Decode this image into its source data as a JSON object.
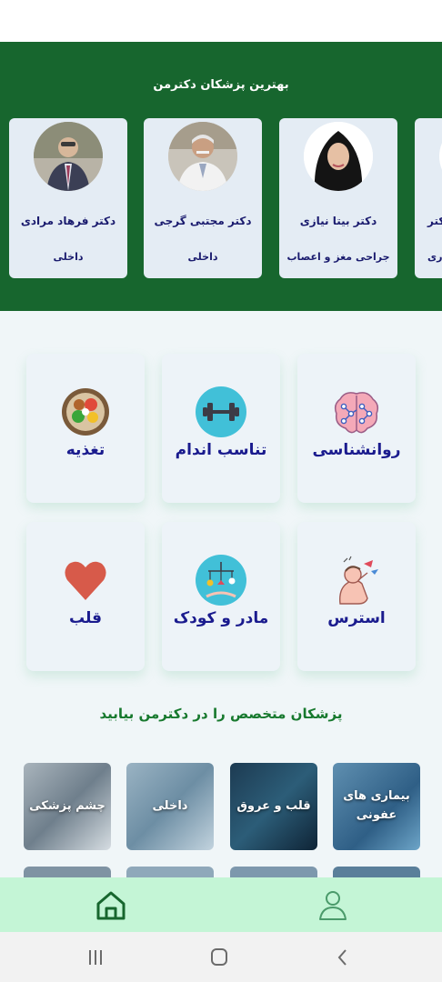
{
  "banner": {
    "title": "بهترین پزشکان دکترمن",
    "doctors": [
      {
        "name": "دکتر فرهاد مرادی",
        "specialty": "داخلی"
      },
      {
        "name": "دکتر مجتبی گرجی",
        "specialty": "داخلی"
      },
      {
        "name": "دکتر بیتا نیازی",
        "specialty": "جراحی مغز و اعصاب"
      },
      {
        "name": "دکتر",
        "specialty": "ری"
      }
    ]
  },
  "categories": [
    {
      "label": "روانشناسی",
      "icon": "brain-icon"
    },
    {
      "label": "تناسب اندام",
      "icon": "dumbbell-icon"
    },
    {
      "label": "تغذیه",
      "icon": "food-bowl-icon"
    },
    {
      "label": "استرس",
      "icon": "stress-icon"
    },
    {
      "label": "مادر و کودک",
      "icon": "baby-mobile-icon"
    },
    {
      "label": "قلب",
      "icon": "heart-icon"
    }
  ],
  "specialists": {
    "title": "پزشکان متخصص را در دکترمن بیابید",
    "items": [
      {
        "label": "بیماری های عفونی"
      },
      {
        "label": "قلب و عروق"
      },
      {
        "label": "داخلی"
      },
      {
        "label": "چشم پزشکی"
      }
    ]
  },
  "bottom_nav": {
    "home_icon": "home-icon",
    "profile_icon": "profile-icon"
  },
  "system_nav": {
    "recents": "recents-icon",
    "home": "system-home-icon",
    "back": "back-icon"
  },
  "colors": {
    "banner": "#17662e",
    "accent_text": "#1a1b8e",
    "section_title": "#17792e",
    "bottom_nav": "#c4f5d6"
  }
}
